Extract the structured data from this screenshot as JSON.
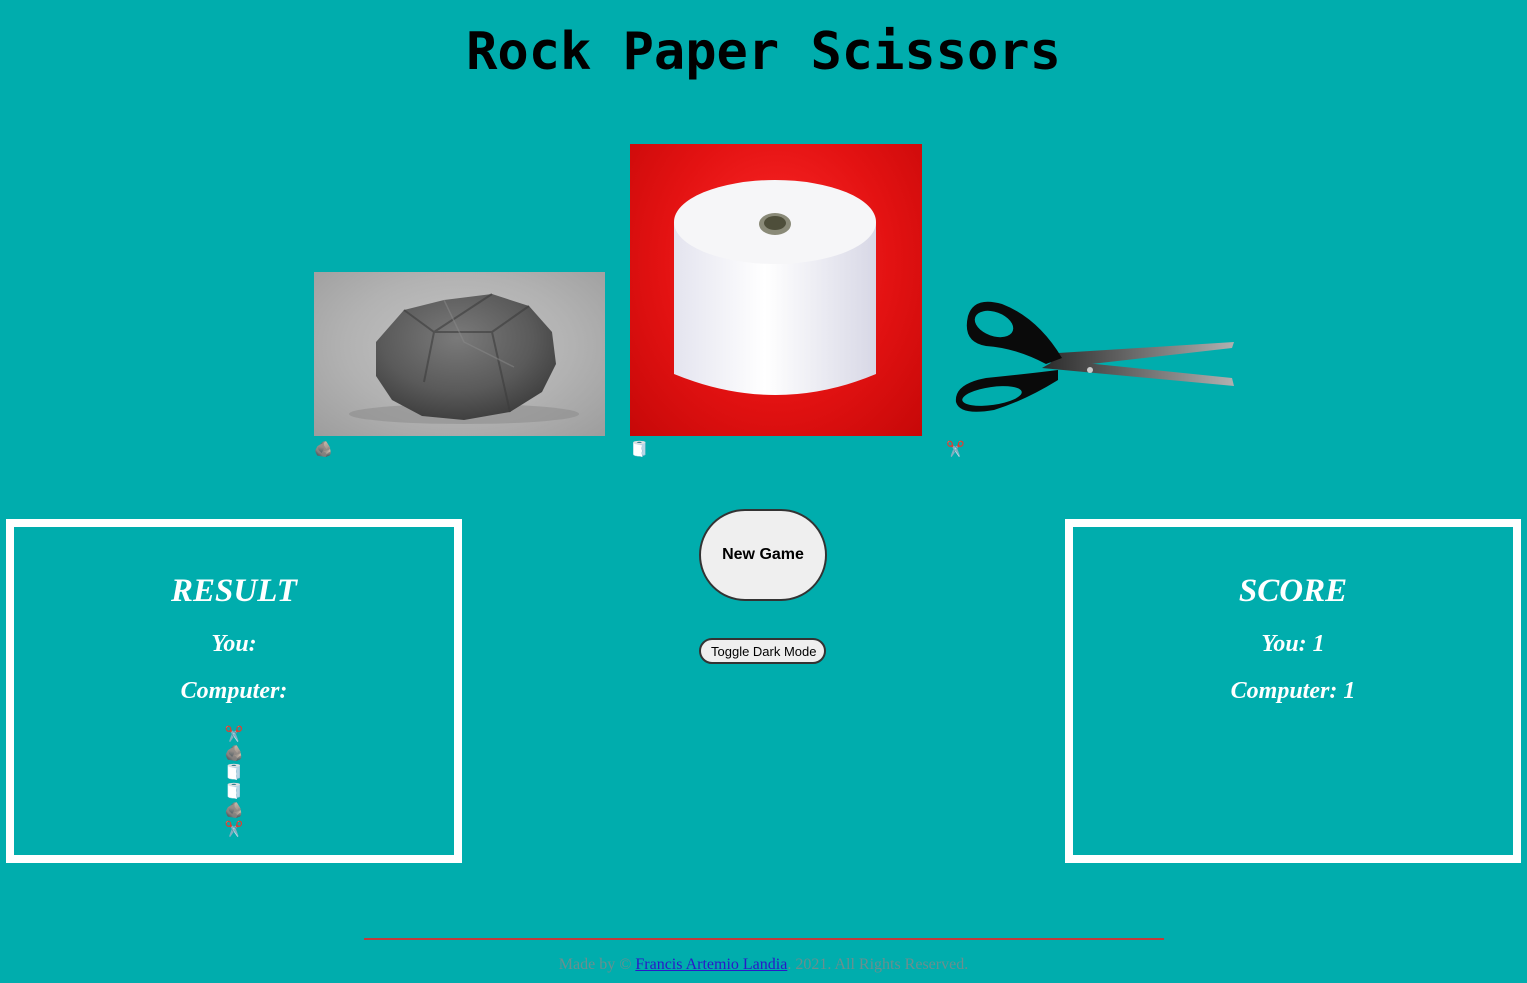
{
  "header": {
    "title": "Rock Paper Scissors"
  },
  "choices": {
    "rock": {
      "emoji": "🪨"
    },
    "paper": {
      "emoji": "🧻"
    },
    "scissors": {
      "emoji": "✂️"
    }
  },
  "result": {
    "heading": "RESULT",
    "you_label": "You:",
    "computer_label": "Computer:",
    "history": [
      "✂️",
      "🪨",
      "🧻",
      "🧻",
      "🪨",
      "✂️"
    ]
  },
  "score": {
    "heading": "SCORE",
    "you": "You: 1",
    "computer": "Computer: 1"
  },
  "buttons": {
    "new_game": "New Game",
    "toggle_dark": "Toggle Dark Mode"
  },
  "footer": {
    "prefix": "Made by ©",
    "author": "Francis Artemio Landia",
    "suffix": "2021. All Rights Reserved."
  },
  "colors": {
    "background": "#00adad",
    "box_border": "#ffffff",
    "footer_rule": "#c23a3a"
  }
}
